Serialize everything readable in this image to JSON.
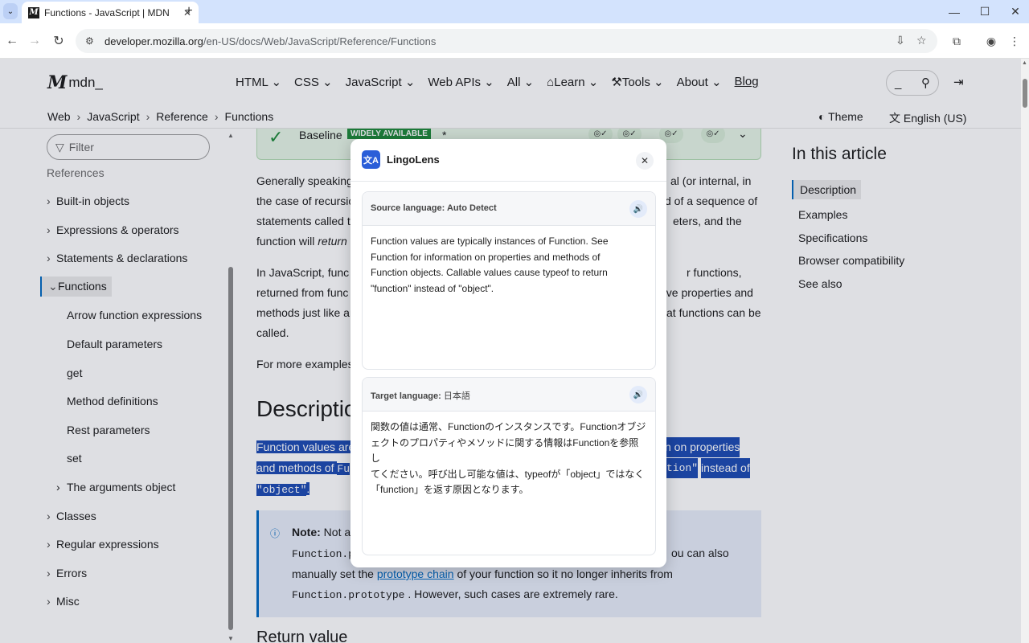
{
  "browser": {
    "tab_title": "Functions - JavaScript | MDN",
    "url_host": "developer.mozilla.org",
    "url_path": "/en-US/docs/Web/JavaScript/Reference/Functions",
    "favicon_letter": "M"
  },
  "mdn": {
    "logo_text": "mdn_",
    "nav": [
      "HTML",
      "CSS",
      "JavaScript",
      "Web APIs",
      "All",
      "Learn",
      "Tools",
      "About",
      "Blog"
    ],
    "search_hint": "_",
    "breadcrumb": [
      "Web",
      "JavaScript",
      "Reference",
      "Functions"
    ],
    "theme_label": "Theme",
    "language_label": "English (US)"
  },
  "sidebar": {
    "filter_placeholder": "Filter",
    "heading": "References",
    "items": [
      "Built-in objects",
      "Expressions & operators",
      "Statements & declarations",
      "Functions"
    ],
    "sub_items": [
      "Arrow function expressions",
      "Default parameters",
      "get",
      "Method definitions",
      "Rest parameters",
      "set",
      "The arguments object"
    ],
    "more_items": [
      "Classes",
      "Regular expressions",
      "Errors",
      "Misc"
    ]
  },
  "content": {
    "baseline_label": "Baseline",
    "baseline_badge": "WIDELY AVAILABLE",
    "baseline_star": "*",
    "p1": [
      "Generally speaking",
      "al (or internal, in",
      "the case of recursio",
      "d of a sequence of",
      "statements called t",
      "eters, and the",
      "function will"
    ],
    "p1_return": "return",
    "p2": [
      "In JavaScript, func",
      "r functions,",
      "returned from func",
      "ave properties and",
      "methods just like ar",
      "at functions can be",
      "called."
    ],
    "p3": "For more examples",
    "heading": "Descriptio",
    "hl1a": "Function values are",
    "hl1b": "n on properties",
    "hl2a": "and methods of",
    "hl2a_code": "Fu",
    "hl2b_code": "tion\"",
    "hl2b": "instead of",
    "hl3_code": "\"object\"",
    "hl3_tail": ".",
    "note_label": "Note:",
    "note_text1": "Not all",
    "note_code1": "Function.p",
    "note_text2": "ou can also",
    "note_text3": "manually set the",
    "note_link": "prototype chain",
    "note_text4": "of your function so it no longer inherits from",
    "note_code2": "Function.prototype",
    "note_text5": ". However, such cases are extremely rare.",
    "subheading": "Return value"
  },
  "toc": {
    "title": "In this article",
    "items": [
      "Description",
      "Examples",
      "Specifications",
      "Browser compatibility",
      "See also"
    ]
  },
  "popup": {
    "title": "LingoLens",
    "source_label": "Source language:",
    "source_value": "Auto Detect",
    "source_text": "Function values are typically instances of Function. See\nFunction for information on properties and methods of\nFunction objects. Callable values cause typeof to return\n\"function\" instead of \"object\".",
    "target_label": "Target language:",
    "target_value": "日本語",
    "target_text": "関数の値は通常、Functionのインスタンスです。Functionオブジ\nェクトのプロパティやメソッドに関する情報はFunctionを参照し\nてください。呼び出し可能な値は、typeofが「object」ではなく\n「function」を返す原因となります。"
  },
  "colors": {
    "accent": "#0069c2",
    "highlight": "#1d4bb3",
    "popup_brand": "#2a5ed8",
    "tabstrip": "#d3e3fd"
  }
}
